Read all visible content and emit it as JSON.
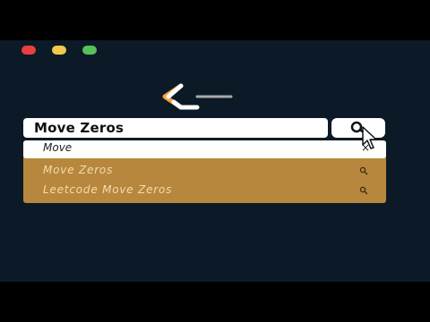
{
  "search": {
    "value": "Move Zeros",
    "dropdown_query": "Move",
    "clear_icon": "×"
  },
  "suggestions": [
    {
      "label": "Move Zeros"
    },
    {
      "label": "Leetcode Move Zeros"
    }
  ],
  "colors": {
    "background": "#0b1a26",
    "panel": "#b8873e",
    "suggestion_text": "#f3dcab"
  },
  "icons": [
    "close-icon",
    "search-icon",
    "leetcode-logo",
    "mouse-cursor-icon"
  ]
}
